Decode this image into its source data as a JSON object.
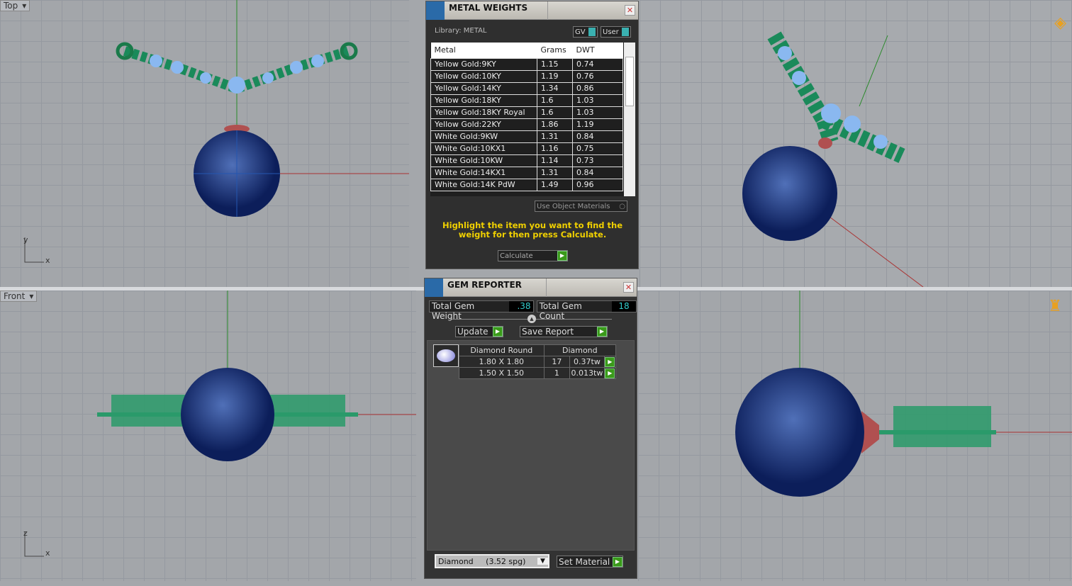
{
  "viewports": {
    "top": "Top",
    "front": "Front"
  },
  "axes": {
    "y": "y",
    "x": "x",
    "z": "z"
  },
  "metal_weights": {
    "title": "METAL WEIGHTS",
    "library": "Library: METAL",
    "gv": "GV",
    "user": "User",
    "columns": [
      "Metal",
      "Grams",
      "DWT"
    ],
    "rows": [
      [
        "Yellow Gold:9KY",
        "1.15",
        "0.74"
      ],
      [
        "Yellow Gold:10KY",
        "1.19",
        "0.76"
      ],
      [
        "Yellow Gold:14KY",
        "1.34",
        "0.86"
      ],
      [
        "Yellow Gold:18KY",
        "1.6",
        "1.03"
      ],
      [
        "Yellow Gold:18KY Royal",
        "1.6",
        "1.03"
      ],
      [
        "Yellow Gold:22KY",
        "1.86",
        "1.19"
      ],
      [
        "White Gold:9KW",
        "1.31",
        "0.84"
      ],
      [
        "White Gold:10KX1",
        "1.16",
        "0.75"
      ],
      [
        "White Gold:10KW",
        "1.14",
        "0.73"
      ],
      [
        "White Gold:14KX1",
        "1.31",
        "0.84"
      ],
      [
        "White Gold:14K PdW",
        "1.49",
        "0.96"
      ]
    ],
    "use_object_materials": "Use Object Materials",
    "hint": "Highlight the item you want to find the weight for then press Calculate.",
    "calculate": "Calculate"
  },
  "gem_reporter": {
    "title": "GEM REPORTER",
    "total_weight_label": "Total Gem Weight",
    "total_weight": ".38",
    "total_count_label": "Total Gem Count",
    "total_count": "18",
    "update": "Update",
    "save_report": "Save Report",
    "header": [
      "Diamond Round",
      "Diamond"
    ],
    "rows": [
      [
        "1.80 X 1.80",
        "17",
        "0.37tw"
      ],
      [
        "1.50 X 1.50",
        "1",
        "0.013tw"
      ]
    ],
    "material_select": "Diamond     (3.52 spg)",
    "set_material": "Set Material"
  }
}
